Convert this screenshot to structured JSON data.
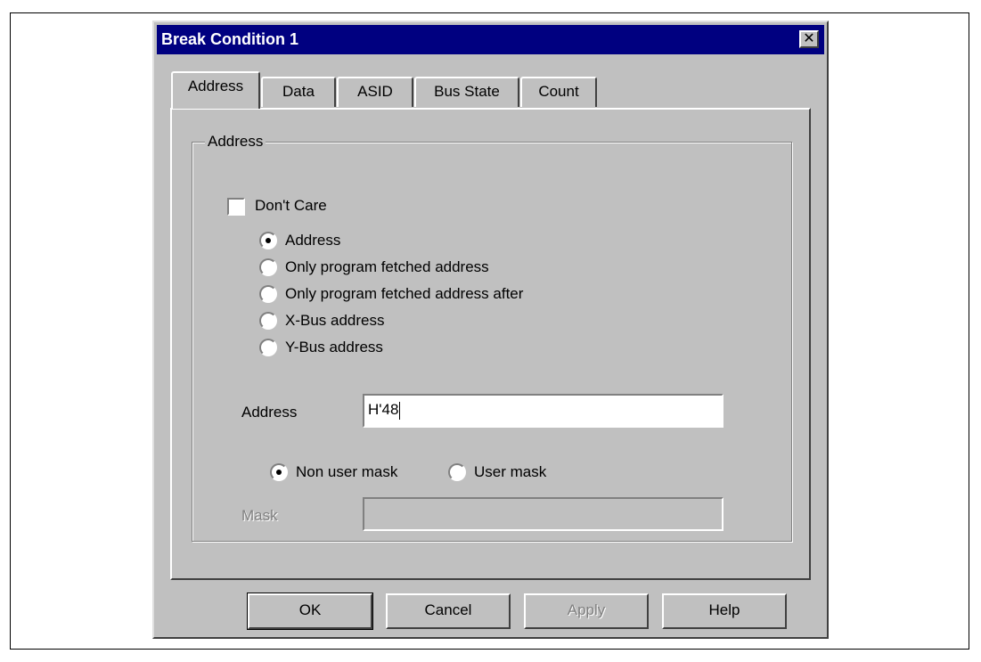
{
  "dialog": {
    "title": "Break Condition 1",
    "close_glyph": "✕"
  },
  "tabs": [
    {
      "label": "Address",
      "active": true
    },
    {
      "label": "Data",
      "active": false
    },
    {
      "label": "ASID",
      "active": false
    },
    {
      "label": "Bus State",
      "active": false
    },
    {
      "label": "Count",
      "active": false
    }
  ],
  "address_group": {
    "legend": "Address",
    "dont_care": {
      "label": "Don't Care",
      "checked": false
    },
    "radios": [
      {
        "label": "Address",
        "selected": true
      },
      {
        "label": "Only program fetched address",
        "selected": false
      },
      {
        "label": "Only program fetched address after",
        "selected": false
      },
      {
        "label": "X-Bus address",
        "selected": false
      },
      {
        "label": "Y-Bus address",
        "selected": false
      }
    ],
    "address_label": "Address",
    "address_value": "H'48",
    "mask_options": [
      {
        "label": "Non user mask",
        "selected": true
      },
      {
        "label": "User mask",
        "selected": false
      }
    ],
    "mask_label": "Mask",
    "mask_value": ""
  },
  "buttons": {
    "ok": "OK",
    "cancel": "Cancel",
    "apply": "Apply",
    "help": "Help"
  },
  "icons": {
    "close": "close-icon",
    "radio_dot": "radio-dot-icon"
  }
}
